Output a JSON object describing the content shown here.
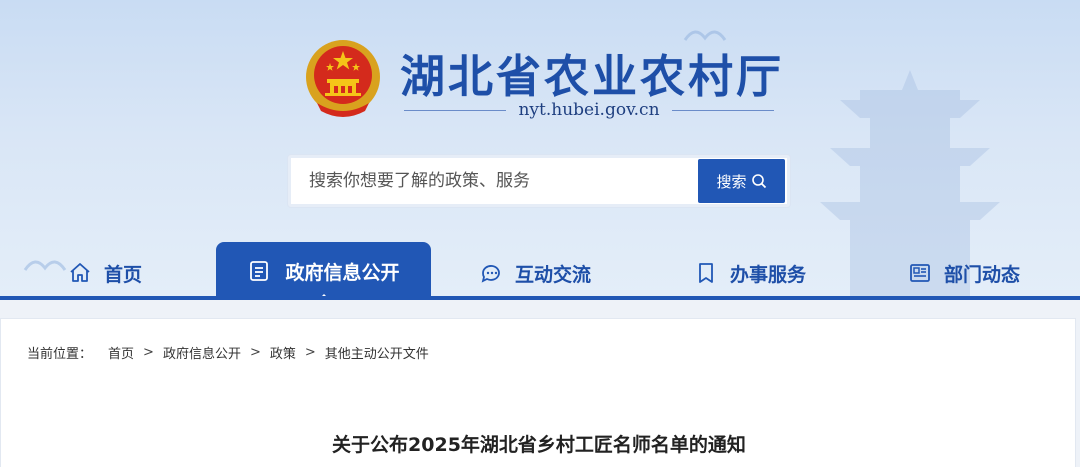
{
  "header": {
    "title": "湖北省农业农村厅",
    "domain": "nyt.hubei.gov.cn",
    "emblem_icon": "national-emblem-icon"
  },
  "search": {
    "placeholder": "搜索你想要了解的政策、服务",
    "button_label": "搜索"
  },
  "nav": {
    "items": [
      {
        "label": "首页",
        "icon": "home-icon"
      },
      {
        "label": "政府信息公开",
        "icon": "document-icon",
        "active": true
      },
      {
        "label": "互动交流",
        "icon": "chat-icon"
      },
      {
        "label": "办事服务",
        "icon": "bookmark-icon"
      },
      {
        "label": "部门动态",
        "icon": "news-icon"
      }
    ]
  },
  "breadcrumb": {
    "lead": "当前位置：",
    "items": [
      "首页",
      "政府信息公开",
      "政策",
      "其他主动公开文件"
    ],
    "separator": ">"
  },
  "article": {
    "title": "关于公布2025年湖北省乡村工匠名师名单的通知"
  },
  "colors": {
    "primary": "#2157b5",
    "title_blue": "#1e4fa8",
    "banner_bg": "#d9e6f6"
  }
}
